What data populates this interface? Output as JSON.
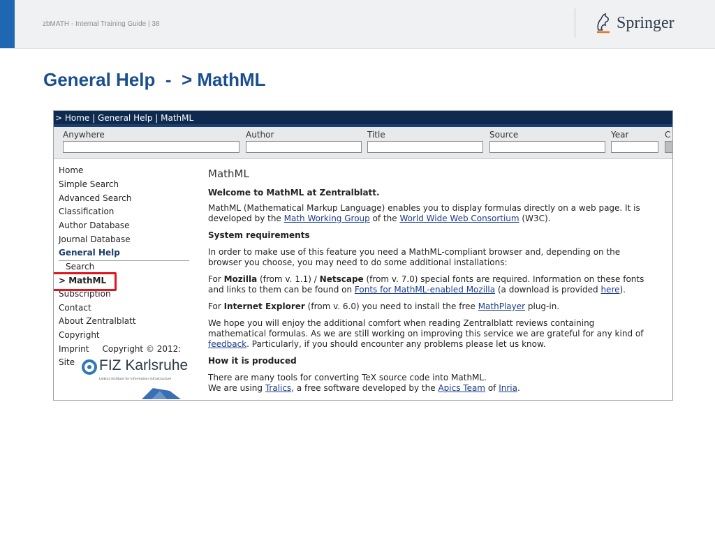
{
  "slide": {
    "footer_text": "zbMATH - Internal Training Guide | 38",
    "title": "General Help  -  > MathML",
    "springer_label": "Springer"
  },
  "screenshot": {
    "breadcrumb": "> Home | General Help | MathML",
    "search_fields": [
      {
        "label": "Anywhere"
      },
      {
        "label": "Author"
      },
      {
        "label": "Title"
      },
      {
        "label": "Source"
      },
      {
        "label": "Year"
      },
      {
        "label": "C"
      }
    ],
    "nav": {
      "items": [
        "Home",
        "Simple Search",
        "Advanced Search",
        "Classification",
        "Author Database",
        "Journal Database",
        "General Help",
        "Search",
        "> MathML",
        "Subscription",
        "Contact",
        "About Zentralblatt",
        "Copyright",
        "Imprint     Copyright © 2012:",
        "Site"
      ]
    },
    "fiz_logo": {
      "name": "FIZ Karlsruhe",
      "subtitle": "Leibniz Institute for Information Infrastructure"
    },
    "content": {
      "heading": "MathML",
      "welcome": "Welcome to MathML at Zentralblatt.",
      "intro_1": "MathML (Mathematical Markup Language) enables you to display formulas directly on a web page. It is",
      "intro_2a": "developed by the ",
      "intro_link1": "Math Working Group",
      "intro_2b": " of the ",
      "intro_link2": "World Wide Web Consortium",
      "intro_2c": " (W3C).",
      "sysreq": "System requirements",
      "req_1": "In order to make use of this feature you need a MathML-compliant browser and, depending on the",
      "req_2": "browser you choose, you may need to do some additional installations:",
      "moz_1a": "For ",
      "moz_1b": "Mozilla",
      "moz_1c": " (from v. 1.1) / ",
      "moz_1d": "Netscape",
      "moz_1e": " (from v. 7.0) special fonts are required. Information on these fonts",
      "moz_2a": "and links to them can be found on ",
      "moz_2link": "Fonts for MathML-enabled Mozilla",
      "moz_2b": " (a download is provided ",
      "moz_2here": "here",
      "moz_2c": ").",
      "ie_a": "For ",
      "ie_b": "Internet Explorer",
      "ie_c": " (from v. 6.0) you need to install the free ",
      "ie_link": "MathPlayer",
      "ie_d": " plug-in.",
      "hope_1": "We hope you will enjoy the additional comfort when reading Zentralblatt reviews containing",
      "hope_2": "mathematical formulas. As we are still working on improving this service we are grateful for any kind of",
      "hope_3link": "feedback",
      "hope_3b": ". Particularly, if you should encounter any problems please let us know.",
      "produced": "How it is produced",
      "prod_1": "There are many tools for converting TeX source code into MathML.",
      "prod_2a": "We are using ",
      "prod_link1": "Tralics",
      "prod_2b": ", a free software developed by the ",
      "prod_link2": "Apics Team",
      "prod_2c": " of ",
      "prod_link3": "Inria",
      "prod_2d": "."
    }
  },
  "colors": {
    "title_blue": "#1b4f8e",
    "topbar_navy": "#0e2a4f",
    "highlight_red": "#e0161c"
  }
}
